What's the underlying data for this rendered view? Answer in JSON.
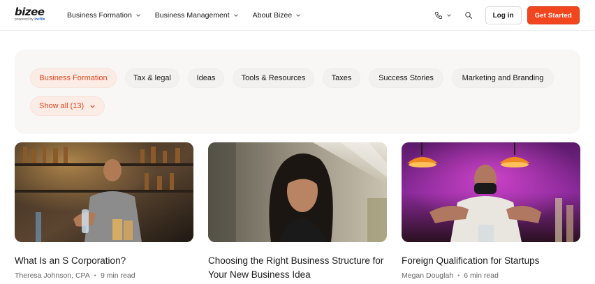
{
  "brand": {
    "name": "bizee",
    "tagline_prefix": "powered by",
    "tagline_brand": "incfile"
  },
  "nav": {
    "items": [
      {
        "label": "Business Formation"
      },
      {
        "label": "Business Management"
      },
      {
        "label": "About Bizee"
      }
    ]
  },
  "header_actions": {
    "phone_icon": "phone-icon",
    "search_icon": "search-icon",
    "login_label": "Log in",
    "cta_label": "Get Started",
    "cta_color": "#f2461f"
  },
  "filters": {
    "categories": [
      {
        "label": "Business Formation",
        "active": true
      },
      {
        "label": "Tax & legal",
        "active": false
      },
      {
        "label": "Ideas",
        "active": false
      },
      {
        "label": "Tools & Resources",
        "active": false
      },
      {
        "label": "Taxes",
        "active": false
      },
      {
        "label": "Success Stories",
        "active": false
      },
      {
        "label": "Marketing and Branding",
        "active": false
      }
    ],
    "show_all_label": "Show all (13)",
    "accent_color": "#e8461e"
  },
  "articles": [
    {
      "title": "What Is an S Corporation?",
      "author": "Theresa Johnson, CPA",
      "read_time": "9 min read"
    },
    {
      "title": "Choosing the Right Business Structure for Your New Business Idea",
      "author": "",
      "read_time": ""
    },
    {
      "title": "Foreign Qualification for Startups",
      "author": "Megan Douglah",
      "read_time": "6 min read"
    }
  ]
}
